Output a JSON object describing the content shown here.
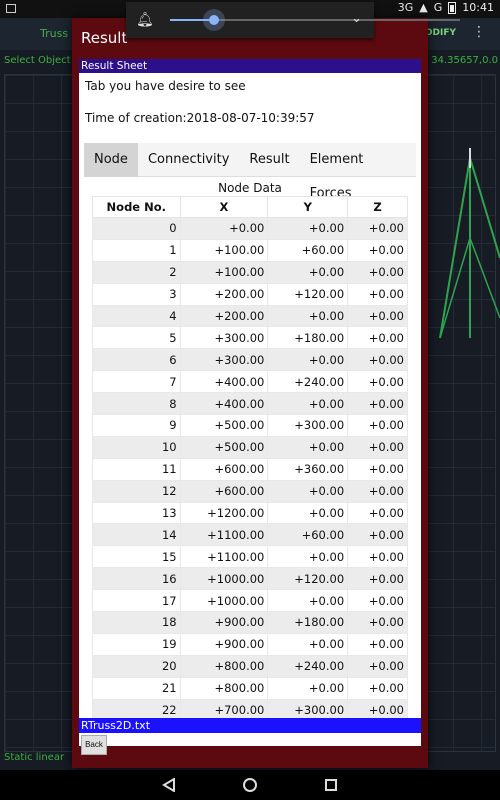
{
  "status_bar": {
    "network": "3G",
    "signal": "G",
    "time": "10:41"
  },
  "background_app": {
    "title": "Truss",
    "modify_label": "ODIFY",
    "sub_left": "Select Object",
    "sub_right": "34.35657,0.0",
    "status": "Static linear"
  },
  "dialog": {
    "title": "Result",
    "sheet_header": "Result Sheet",
    "instruction": "Tab you have desire to see",
    "creation_time": "Time of creation:2018-08-07-10:39:57",
    "tabs": [
      "Node",
      "Connectivity",
      "Result",
      "Element Forces"
    ],
    "active_tab": "Node",
    "table_caption": "Node Data",
    "columns": [
      "Node No.",
      "X",
      "Y",
      "Z"
    ],
    "rows": [
      [
        "0",
        "+0.00",
        "+0.00",
        "+0.00"
      ],
      [
        "1",
        "+100.00",
        "+60.00",
        "+0.00"
      ],
      [
        "2",
        "+100.00",
        "+0.00",
        "+0.00"
      ],
      [
        "3",
        "+200.00",
        "+120.00",
        "+0.00"
      ],
      [
        "4",
        "+200.00",
        "+0.00",
        "+0.00"
      ],
      [
        "5",
        "+300.00",
        "+180.00",
        "+0.00"
      ],
      [
        "6",
        "+300.00",
        "+0.00",
        "+0.00"
      ],
      [
        "7",
        "+400.00",
        "+240.00",
        "+0.00"
      ],
      [
        "8",
        "+400.00",
        "+0.00",
        "+0.00"
      ],
      [
        "9",
        "+500.00",
        "+300.00",
        "+0.00"
      ],
      [
        "10",
        "+500.00",
        "+0.00",
        "+0.00"
      ],
      [
        "11",
        "+600.00",
        "+360.00",
        "+0.00"
      ],
      [
        "12",
        "+600.00",
        "+0.00",
        "+0.00"
      ],
      [
        "13",
        "+1200.00",
        "+0.00",
        "+0.00"
      ],
      [
        "14",
        "+1100.00",
        "+60.00",
        "+0.00"
      ],
      [
        "15",
        "+1100.00",
        "+0.00",
        "+0.00"
      ],
      [
        "16",
        "+1000.00",
        "+120.00",
        "+0.00"
      ],
      [
        "17",
        "+1000.00",
        "+0.00",
        "+0.00"
      ],
      [
        "18",
        "+900.00",
        "+180.00",
        "+0.00"
      ],
      [
        "19",
        "+900.00",
        "+0.00",
        "+0.00"
      ],
      [
        "20",
        "+800.00",
        "+240.00",
        "+0.00"
      ],
      [
        "21",
        "+800.00",
        "+0.00",
        "+0.00"
      ],
      [
        "22",
        "+700.00",
        "+300.00",
        "+0.00"
      ]
    ],
    "file_name": "RTruss2D.txt",
    "back_label": "Back"
  },
  "volume": {
    "level": 0.15
  },
  "colors": {
    "dialog_bg": "#5c0a0f",
    "sheet_header": "#2c0f8a",
    "file_bar": "#1a12ff",
    "accent_green": "#3cb043"
  }
}
